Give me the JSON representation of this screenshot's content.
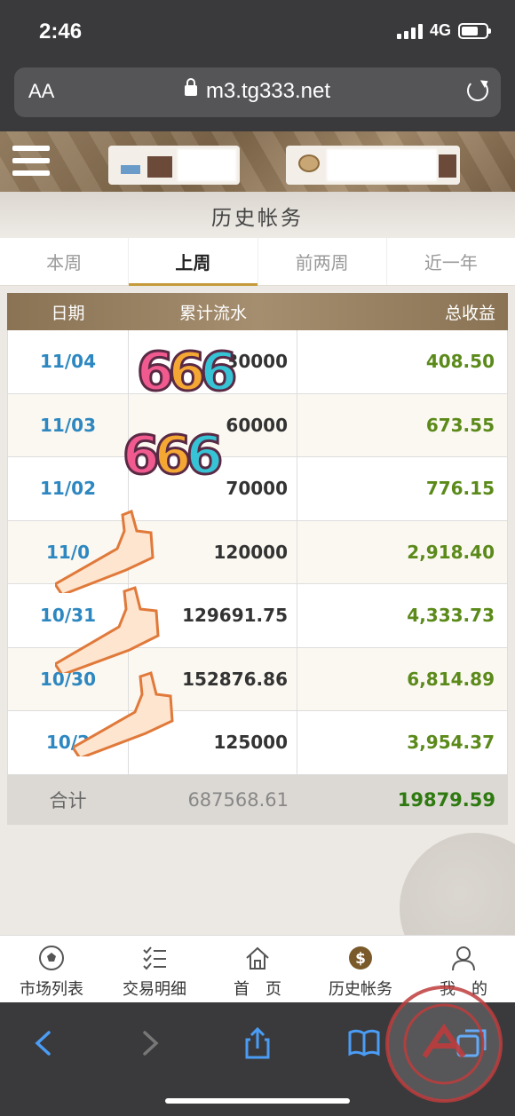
{
  "status_bar": {
    "time": "2:46",
    "network": "4G"
  },
  "browser": {
    "text_size_label": "AA",
    "url": "m3.tg333.net"
  },
  "page": {
    "title": "历史帐务",
    "tabs": [
      {
        "label": "本周",
        "active": false
      },
      {
        "label": "上周",
        "active": true
      },
      {
        "label": "前两周",
        "active": false
      },
      {
        "label": "近一年",
        "active": false
      }
    ],
    "table": {
      "headers": {
        "date": "日期",
        "turnover": "累计流水",
        "profit": "总收益"
      },
      "rows": [
        {
          "date": "11/04",
          "turnover": "30000",
          "profit": "408.50"
        },
        {
          "date": "11/03",
          "turnover": "60000",
          "profit": "673.55"
        },
        {
          "date": "11/02",
          "turnover": "70000",
          "profit": "776.15"
        },
        {
          "date": "11/0",
          "turnover": "120000",
          "profit": "2,918.40"
        },
        {
          "date": "10/31",
          "turnover": "129691.75",
          "profit": "4,333.73"
        },
        {
          "date": "10/30",
          "turnover": "152876.86",
          "profit": "6,814.89"
        },
        {
          "date": "10/2",
          "turnover": "125000",
          "profit": "3,954.37"
        }
      ],
      "total": {
        "label": "合计",
        "turnover": "687568.61",
        "profit": "19879.59"
      }
    },
    "stickers": [
      {
        "text": "666"
      },
      {
        "text": "666"
      }
    ]
  },
  "bottom_nav": [
    {
      "label": "市场列表",
      "icon": "soccer-ball-icon"
    },
    {
      "label": "交易明细",
      "icon": "checklist-icon"
    },
    {
      "label": "首　页",
      "icon": "home-icon"
    },
    {
      "label": "历史帐务",
      "icon": "dollar-coin-icon"
    },
    {
      "label": "我　的",
      "icon": "user-icon"
    }
  ],
  "colors": {
    "accent_gold": "#c49a3a",
    "date_blue": "#2d87c0",
    "profit_green": "#5b8a1a",
    "header_brown": "#8a7354"
  }
}
